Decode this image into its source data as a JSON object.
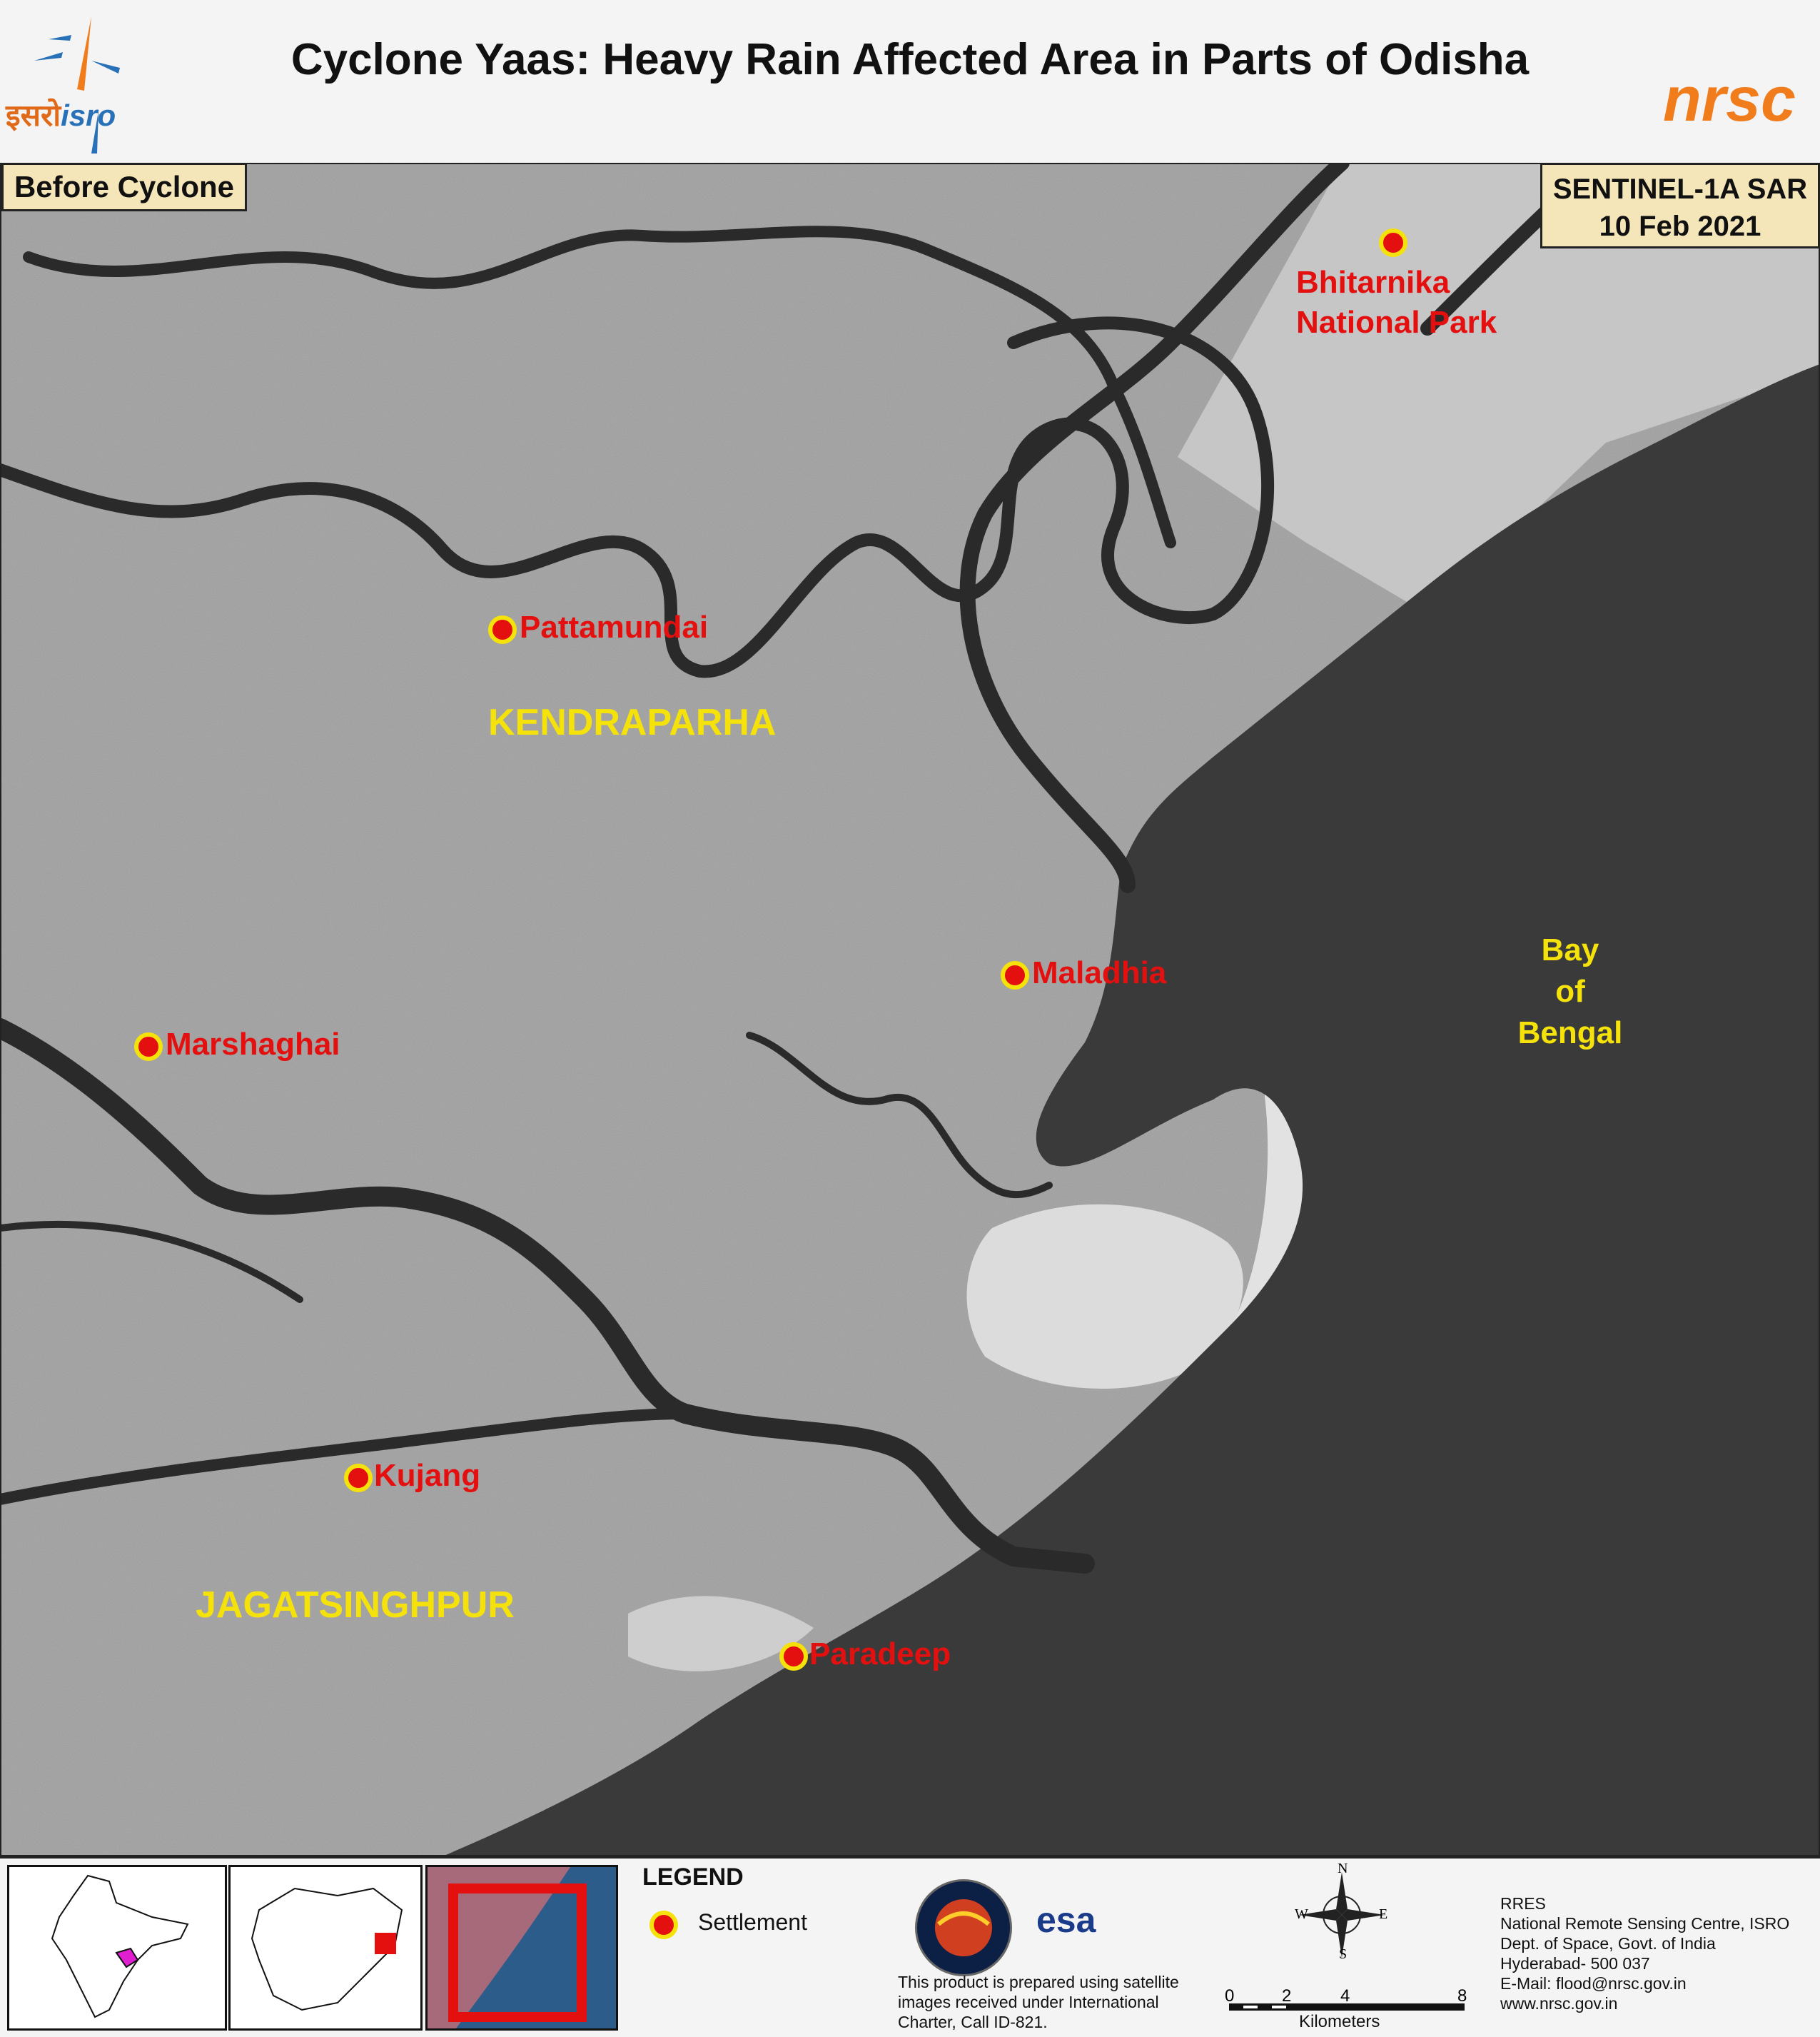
{
  "header": {
    "title": "Cyclone Yaas:  Heavy Rain Affected Area in Parts of Odisha",
    "isro_logo_hindi": "इसरो",
    "isro_logo_english": "isro",
    "nrsc_logo": "nrsc"
  },
  "map": {
    "before_label": "Before Cyclone",
    "sensor": "SENTINEL-1A SAR",
    "date": "10 Feb 2021",
    "settlements": [
      {
        "name": "Bhitarnika",
        "name2": "National Park"
      },
      {
        "name": "Pattamundai"
      },
      {
        "name": "Maladhia"
      },
      {
        "name": "Marshaghai"
      },
      {
        "name": "Kujang"
      },
      {
        "name": "Paradeep"
      }
    ],
    "districts": [
      "KENDRAPARHA",
      "JAGATSINGHPUR"
    ],
    "sea_label": [
      "Bay",
      "of",
      "Bengal"
    ],
    "colors": {
      "settlement": "#e41010",
      "label_yellow": "#f5e20a",
      "sea": "#3a3a3a"
    }
  },
  "legend": {
    "title": "LEGEND",
    "items": [
      {
        "label": "Settlement"
      }
    ]
  },
  "credits": {
    "disclaimer": "This product is prepared using satellite images received under International Charter, Call ID-821.",
    "esa": "esa"
  },
  "compass": {
    "n": "N",
    "s": "S",
    "e": "E",
    "w": "W"
  },
  "scale": {
    "ticks": [
      "0",
      "2",
      "4",
      "8"
    ],
    "unit": "Kilometers"
  },
  "address": [
    "RRES",
    "National Remote Sensing Centre, ISRO",
    "Dept. of Space, Govt. of India",
    "Hyderabad- 500 037",
    "E-Mail: flood@nrsc.gov.in",
    "www.nrsc.gov.in"
  ]
}
